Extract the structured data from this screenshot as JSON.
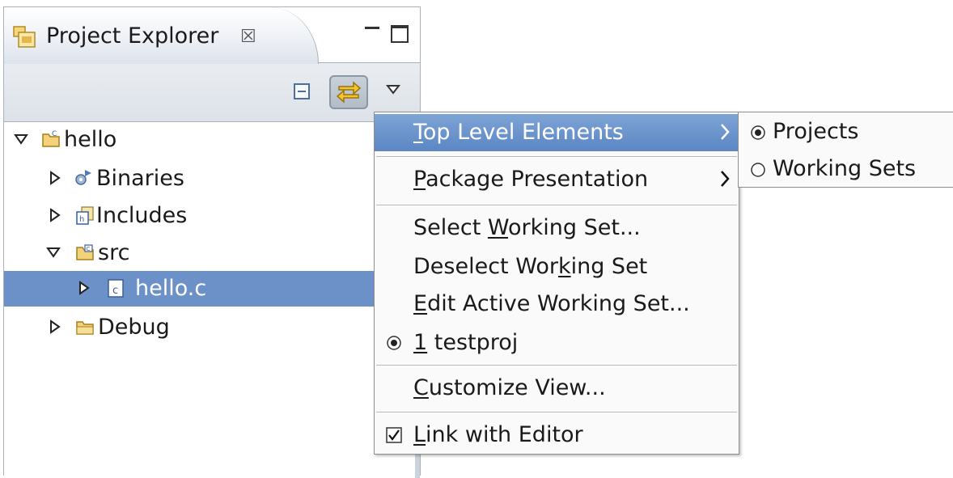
{
  "view": {
    "title": "Project Explorer",
    "close_glyph": "☒",
    "tab_icon": "project-explorer-icon",
    "toolbar": {
      "collapse_icon": "collapse-all-icon",
      "link_icon": "link-with-editor-icon",
      "menu_icon": "view-menu-icon"
    }
  },
  "tree": [
    {
      "label": "hello",
      "icon": "c-project-icon",
      "expanded": true
    },
    {
      "label": "Binaries",
      "icon": "binaries-icon",
      "expanded": false
    },
    {
      "label": "Includes",
      "icon": "includes-icon",
      "expanded": false
    },
    {
      "label": "src",
      "icon": "source-folder-icon",
      "expanded": true
    },
    {
      "label": "hello.c",
      "icon": "c-file-icon",
      "expanded": false,
      "selected": true
    },
    {
      "label": "Debug",
      "icon": "folder-icon",
      "expanded": false
    }
  ],
  "menu": {
    "top_level": {
      "pre": "",
      "mn": "T",
      "post": "op Level Elements"
    },
    "package_presentation": {
      "pre": "",
      "mn": "P",
      "post": "ackage Presentation"
    },
    "select_ws": {
      "pre": "Select ",
      "mn": "W",
      "post": "orking Set..."
    },
    "deselect_ws": {
      "pre": "Deselect Wor",
      "mn": "k",
      "post": "ing Set"
    },
    "edit_ws": {
      "pre": "",
      "mn": "E",
      "post": "dit Active Working Set..."
    },
    "testproj": {
      "pre": "",
      "mn": "1",
      "post": " testproj",
      "checked": true
    },
    "customize": {
      "pre": "",
      "mn": "C",
      "post": "ustomize View..."
    },
    "link_editor": {
      "pre": "",
      "mn": "L",
      "post": "ink with Editor",
      "checked": true
    }
  },
  "submenu": {
    "projects": {
      "label": "Projects",
      "selected": true
    },
    "working_sets": {
      "label": "Working Sets",
      "selected": false
    }
  },
  "colors": {
    "selection": "#6b91c8",
    "menu_highlight": "#5b86c4",
    "border": "#a8b2bd"
  }
}
